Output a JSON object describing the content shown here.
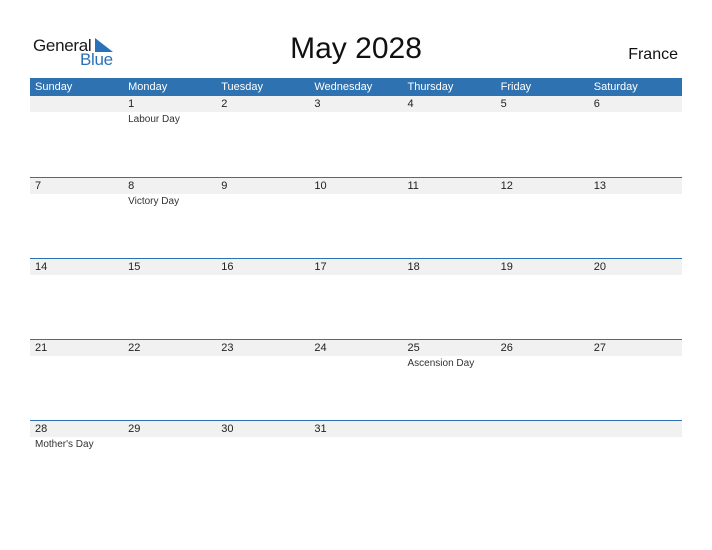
{
  "logo": {
    "word1": "General",
    "word2": "Blue"
  },
  "title": "May 2028",
  "country": "France",
  "weekdays": [
    "Sunday",
    "Monday",
    "Tuesday",
    "Wednesday",
    "Thursday",
    "Friday",
    "Saturday"
  ],
  "weeks": [
    [
      {
        "d": "",
        "e": ""
      },
      {
        "d": "1",
        "e": "Labour Day"
      },
      {
        "d": "2",
        "e": ""
      },
      {
        "d": "3",
        "e": ""
      },
      {
        "d": "4",
        "e": ""
      },
      {
        "d": "5",
        "e": ""
      },
      {
        "d": "6",
        "e": ""
      }
    ],
    [
      {
        "d": "7",
        "e": ""
      },
      {
        "d": "8",
        "e": "Victory Day"
      },
      {
        "d": "9",
        "e": ""
      },
      {
        "d": "10",
        "e": ""
      },
      {
        "d": "11",
        "e": ""
      },
      {
        "d": "12",
        "e": ""
      },
      {
        "d": "13",
        "e": ""
      }
    ],
    [
      {
        "d": "14",
        "e": ""
      },
      {
        "d": "15",
        "e": ""
      },
      {
        "d": "16",
        "e": ""
      },
      {
        "d": "17",
        "e": ""
      },
      {
        "d": "18",
        "e": ""
      },
      {
        "d": "19",
        "e": ""
      },
      {
        "d": "20",
        "e": ""
      }
    ],
    [
      {
        "d": "21",
        "e": ""
      },
      {
        "d": "22",
        "e": ""
      },
      {
        "d": "23",
        "e": ""
      },
      {
        "d": "24",
        "e": ""
      },
      {
        "d": "25",
        "e": "Ascension Day"
      },
      {
        "d": "26",
        "e": ""
      },
      {
        "d": "27",
        "e": ""
      }
    ],
    [
      {
        "d": "28",
        "e": "Mother's Day"
      },
      {
        "d": "29",
        "e": ""
      },
      {
        "d": "30",
        "e": ""
      },
      {
        "d": "31",
        "e": ""
      },
      {
        "d": "",
        "e": ""
      },
      {
        "d": "",
        "e": ""
      },
      {
        "d": "",
        "e": ""
      }
    ]
  ],
  "colors": {
    "accent": "#2e72b1",
    "band": "#f1f1f1"
  }
}
